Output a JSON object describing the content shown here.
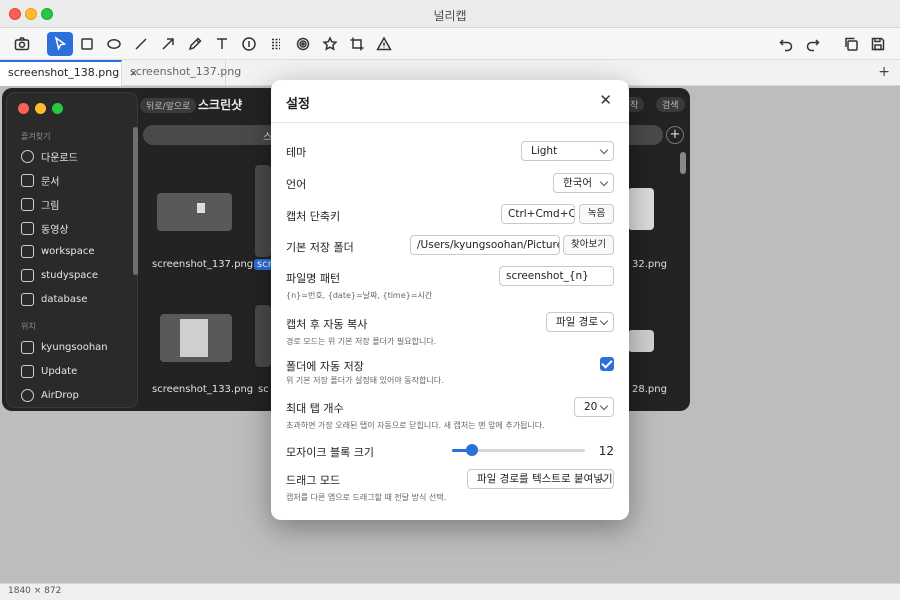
{
  "window": {
    "title": "널리캡"
  },
  "toolbar": {
    "icons": [
      "camera-icon",
      "pointer-icon",
      "rectangle-icon",
      "ellipse-icon",
      "line-icon",
      "arrow-icon",
      "pen-icon",
      "text-icon",
      "number-icon",
      "mosaic-icon",
      "blur-icon",
      "star-icon",
      "crop-icon",
      "warning-icon",
      "undo-icon",
      "redo-icon",
      "copy-icon",
      "save-icon"
    ],
    "active": "pointer-icon"
  },
  "tabs": [
    {
      "label": "screenshot_138.png",
      "close": "×",
      "active": true
    },
    {
      "label": "screenshot_137.png",
      "active": false
    }
  ],
  "tab_add": "+",
  "capture": {
    "sidebar_favorites": "즐겨찾기",
    "favorites": [
      "다운로드",
      "문서",
      "그림",
      "동영상",
      "workspace",
      "studyspace",
      "database"
    ],
    "sidebar_locations": "위치",
    "locations": [
      "kyungsoohan",
      "Update",
      "AirDrop"
    ],
    "back": "뒤로/앞으로",
    "title": "스크린샷",
    "tag_left": "작",
    "tag_right": "검색",
    "files_row1": [
      "screenshot_137.png",
      "scr",
      "32.png"
    ],
    "files_row2": [
      "screenshot_133.png",
      "sc",
      "28.png"
    ],
    "search_letter": "스"
  },
  "statusbar": {
    "dimensions": "1840 × 872"
  },
  "settings": {
    "title": "설정",
    "close": "✕",
    "theme": {
      "label": "테마",
      "value": "Light"
    },
    "language": {
      "label": "언어",
      "value": "한국어"
    },
    "shortcut": {
      "label": "캡처 단축키",
      "value": "Ctrl+Cmd+C",
      "record": "녹음"
    },
    "folder": {
      "label": "기본 저장 폴더",
      "value": "/Users/kyungsoohan/Pictures/스",
      "browse": "찾아보기"
    },
    "filename": {
      "label": "파일명 패턴",
      "value": "screenshot_{n}",
      "hint": "{n}=번호, {date}=날짜, {time}=시간"
    },
    "autocopy": {
      "label": "캡처 후 자동 복사",
      "value": "파일 경로",
      "hint": "경로 모드는 위 기본 저장 폴더가 필요합니다."
    },
    "autosave": {
      "label": "폴더에 자동 저장",
      "checked": true,
      "hint": "위 기본 저장 폴더가 설정돼 있어야 동작합니다."
    },
    "maxtabs": {
      "label": "최대 탭 개수",
      "value": "20",
      "hint": "초과하면 가장 오래된 탭이 자동으로 닫힙니다. 새 캡처는 맨 앞에 추가됩니다."
    },
    "mosaic": {
      "label": "모자이크 블록 크기",
      "value": "12",
      "fraction": 0.15
    },
    "drag": {
      "label": "드래그 모드",
      "value": "파일 경로를 텍스트로 붙여넣기",
      "hint": "캡처를 다른 앱으로 드래그할 때 전달 방식 선택."
    }
  }
}
